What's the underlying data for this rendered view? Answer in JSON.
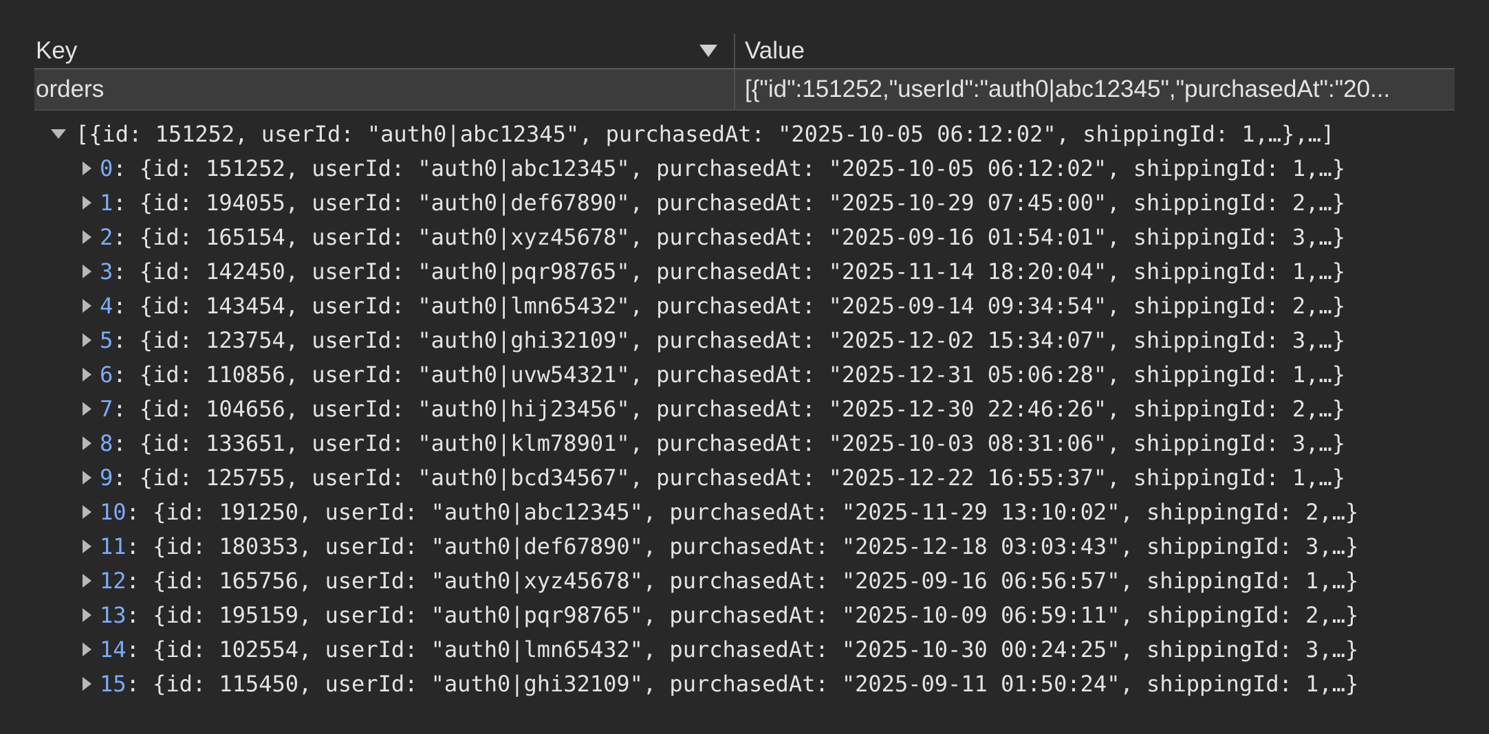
{
  "table": {
    "headers": {
      "key": "Key",
      "value": "Value"
    },
    "rows": [
      {
        "key": "orders",
        "value": "[{\"id\":151252,\"userId\":\"auth0|abc12345\",\"purchasedAt\":\"20..."
      }
    ]
  },
  "tree": {
    "root_preview": "[{id: 151252, userId: \"auth0|abc12345\", purchasedAt: \"2025-10-05 06:12:02\", shippingId: 1,…},…]",
    "items": [
      {
        "index": "0",
        "preview": "{id: 151252, userId: \"auth0|abc12345\", purchasedAt: \"2025-10-05 06:12:02\", shippingId: 1,…}"
      },
      {
        "index": "1",
        "preview": "{id: 194055, userId: \"auth0|def67890\", purchasedAt: \"2025-10-29 07:45:00\", shippingId: 2,…}"
      },
      {
        "index": "2",
        "preview": "{id: 165154, userId: \"auth0|xyz45678\", purchasedAt: \"2025-09-16 01:54:01\", shippingId: 3,…}"
      },
      {
        "index": "3",
        "preview": "{id: 142450, userId: \"auth0|pqr98765\", purchasedAt: \"2025-11-14 18:20:04\", shippingId: 1,…}"
      },
      {
        "index": "4",
        "preview": "{id: 143454, userId: \"auth0|lmn65432\", purchasedAt: \"2025-09-14 09:34:54\", shippingId: 2,…}"
      },
      {
        "index": "5",
        "preview": "{id: 123754, userId: \"auth0|ghi32109\", purchasedAt: \"2025-12-02 15:34:07\", shippingId: 3,…}"
      },
      {
        "index": "6",
        "preview": "{id: 110856, userId: \"auth0|uvw54321\", purchasedAt: \"2025-12-31 05:06:28\", shippingId: 1,…}"
      },
      {
        "index": "7",
        "preview": "{id: 104656, userId: \"auth0|hij23456\", purchasedAt: \"2025-12-30 22:46:26\", shippingId: 2,…}"
      },
      {
        "index": "8",
        "preview": "{id: 133651, userId: \"auth0|klm78901\", purchasedAt: \"2025-10-03 08:31:06\", shippingId: 3,…}"
      },
      {
        "index": "9",
        "preview": "{id: 125755, userId: \"auth0|bcd34567\", purchasedAt: \"2025-12-22 16:55:37\", shippingId: 1,…}"
      },
      {
        "index": "10",
        "preview": "{id: 191250, userId: \"auth0|abc12345\", purchasedAt: \"2025-11-29 13:10:02\", shippingId: 2,…}"
      },
      {
        "index": "11",
        "preview": "{id: 180353, userId: \"auth0|def67890\", purchasedAt: \"2025-12-18 03:03:43\", shippingId: 3,…}"
      },
      {
        "index": "12",
        "preview": "{id: 165756, userId: \"auth0|xyz45678\", purchasedAt: \"2025-09-16 06:56:57\", shippingId: 1,…}"
      },
      {
        "index": "13",
        "preview": "{id: 195159, userId: \"auth0|pqr98765\", purchasedAt: \"2025-10-09 06:59:11\", shippingId: 2,…}"
      },
      {
        "index": "14",
        "preview": "{id: 102554, userId: \"auth0|lmn65432\", purchasedAt: \"2025-10-30 00:24:25\", shippingId: 3,…}"
      },
      {
        "index": "15",
        "preview": "{id: 115450, userId: \"auth0|ghi32109\", purchasedAt: \"2025-09-11 01:50:24\", shippingId: 1,…}"
      }
    ]
  },
  "colors": {
    "background": "#282828",
    "row_selected": "#3c3c3c",
    "index_blue": "#7cacf8",
    "text": "#e3e3e3"
  },
  "icons": {
    "sort": "triangle-down-icon",
    "expanded": "triangle-down-icon",
    "collapsed": "triangle-right-icon"
  }
}
